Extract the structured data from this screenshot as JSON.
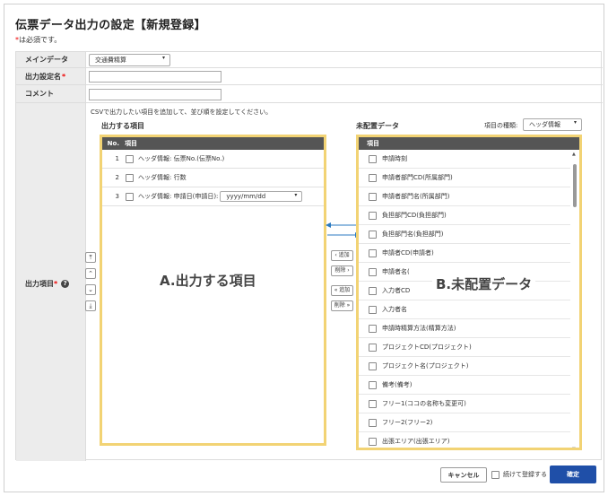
{
  "page": {
    "title": "伝票データ出力の設定【新規登録】",
    "required_star": "*",
    "required_note": "は必須です。"
  },
  "form": {
    "main_data": {
      "label": "メインデータ",
      "value": "交通費精算"
    },
    "name": {
      "label": "出力設定名",
      "star": "*",
      "value": ""
    },
    "comment": {
      "label": "コメント",
      "value": ""
    },
    "output": {
      "label": "出力項目",
      "star": "*"
    }
  },
  "description": "CSVで出力したい項目を追加して、並び順を設定してください。",
  "output_list": {
    "heading": "出力する項目",
    "col_no": "No.",
    "col_item": "項目",
    "rows": [
      {
        "no": "1",
        "label": "ヘッダ情報: 伝票No.(伝票No.)"
      },
      {
        "no": "2",
        "label": "ヘッダ情報: 行数"
      },
      {
        "no": "3",
        "label": "ヘッダ情報: 申請日(申請日):",
        "format": "yyyy/mm/dd"
      }
    ],
    "annotation": "A.出力する項目"
  },
  "unplaced": {
    "heading": "未配置データ",
    "type_label": "項目の種類:",
    "type_value": "ヘッダ情報",
    "col_item": "項目",
    "items": [
      "申請時刻",
      "申請者部門CD(所属部門)",
      "申請者部門名(所属部門)",
      "負担部門CD(負担部門)",
      "負担部門名(負担部門)",
      "申請者CD(申請者)",
      "申請者名(",
      "入力者CD",
      "入力者名",
      "申請時精算方法(精算方法)",
      "プロジェクトCD(プロジェクト)",
      "プロジェクト名(プロジェクト)",
      "備考(備考)",
      "フリー1(ココの名称も変更可)",
      "フリー2(フリー2)",
      "出張エリア(出張エリア)"
    ],
    "annotation": "B.未配置データ"
  },
  "sort_buttons": {
    "top": "⤒",
    "up": "⌃",
    "down": "⌄",
    "bottom": "⤓"
  },
  "move_buttons": {
    "add": "‹ 追加",
    "remove": "削除 ›",
    "add_all": "« 追加",
    "remove_all": "削除 »"
  },
  "footer": {
    "cancel": "キャンセル",
    "continue": "続けて登録する",
    "confirm": "確定"
  },
  "colors": {
    "highlight": "#f2d374",
    "arrow": "#2a7ac0",
    "primary": "#1f4fa8",
    "header": "#555555"
  }
}
